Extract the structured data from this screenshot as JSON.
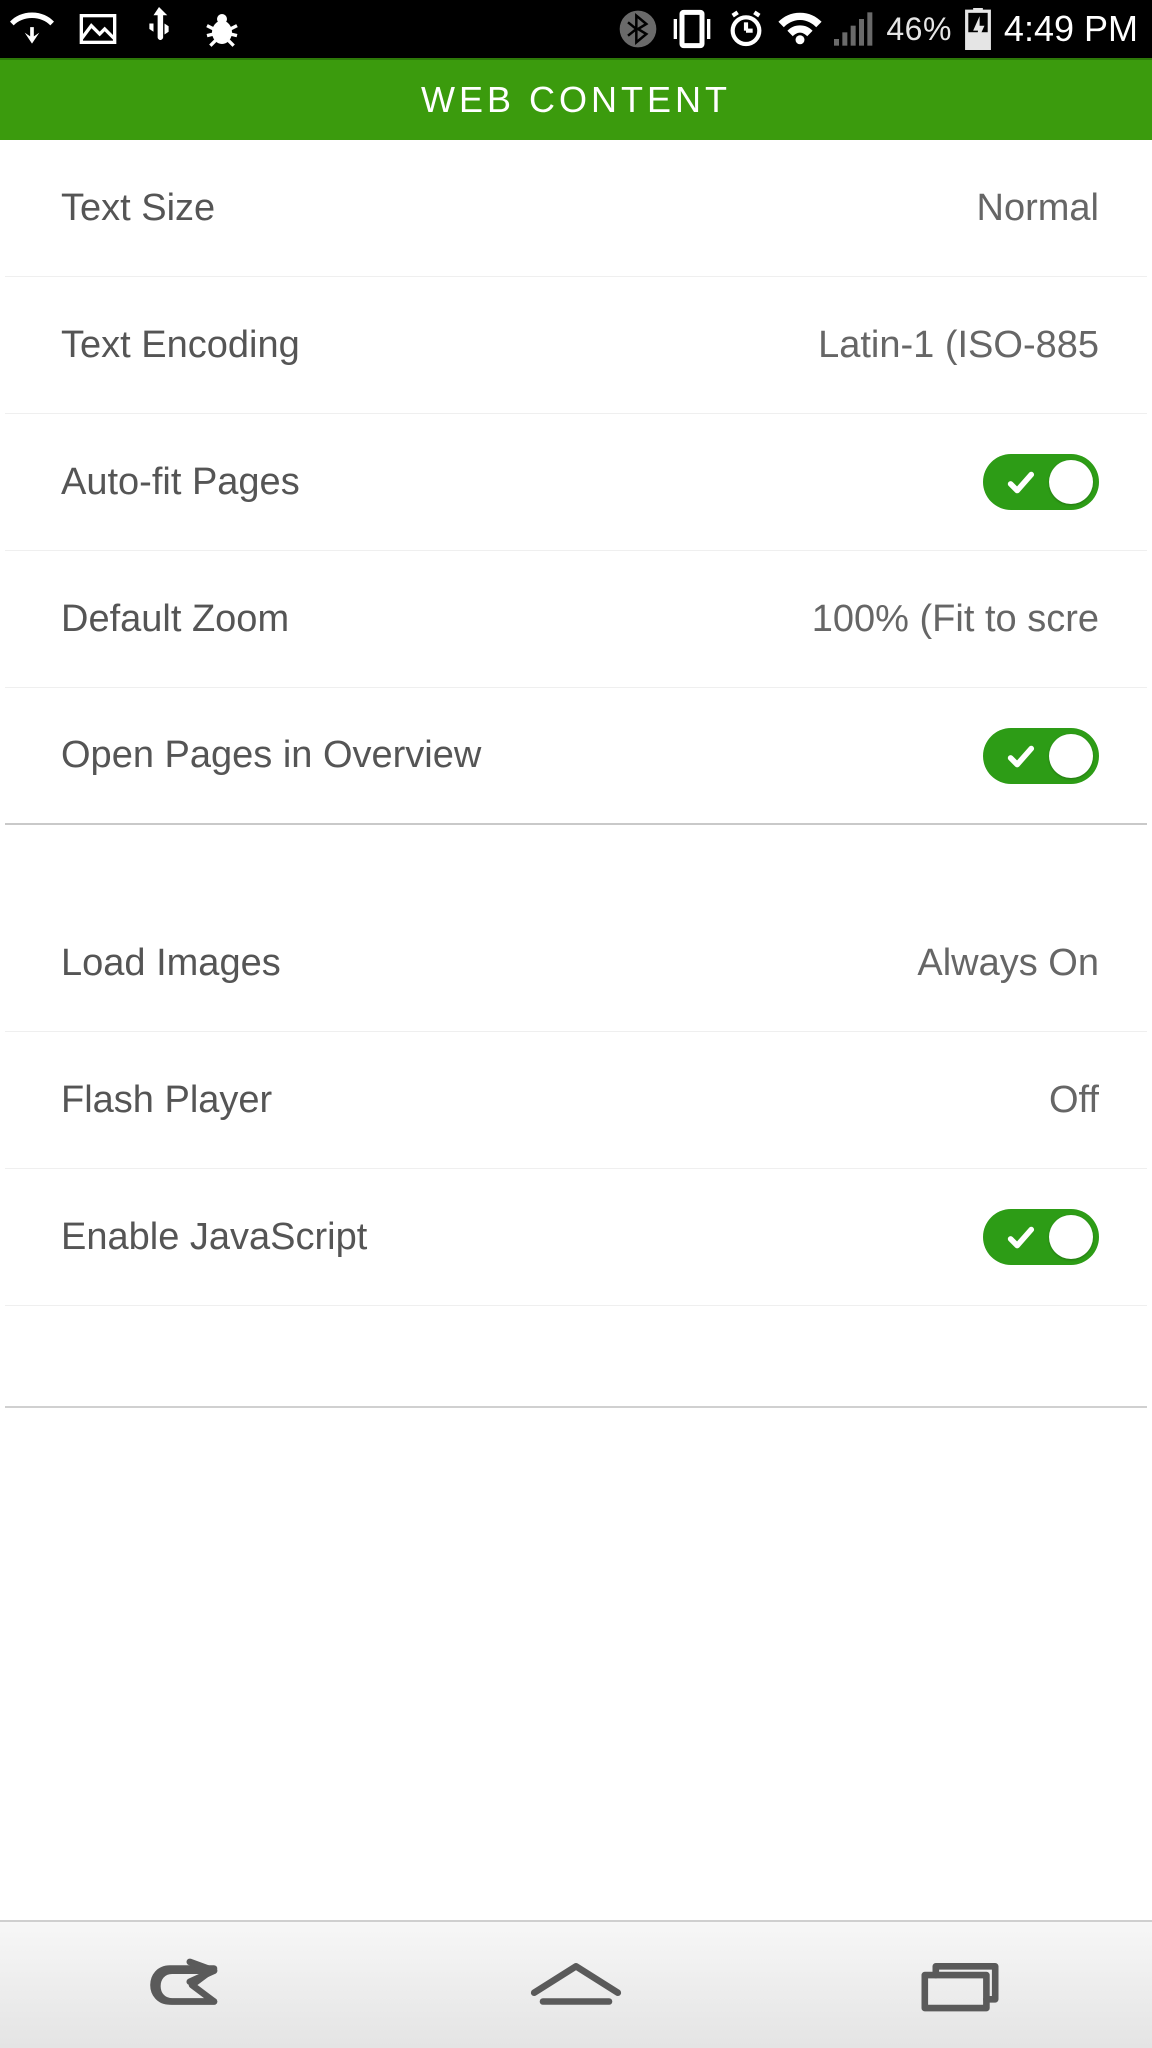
{
  "statusbar": {
    "battery_text": "46%",
    "time": "4:49 PM"
  },
  "header": {
    "title": "WEB CONTENT"
  },
  "settings": {
    "text_size": {
      "label": "Text Size",
      "value": "Normal"
    },
    "text_encoding": {
      "label": "Text Encoding",
      "value": "Latin-1 (ISO-885"
    },
    "auto_fit": {
      "label": "Auto-fit Pages",
      "on": true
    },
    "default_zoom": {
      "label": "Default Zoom",
      "value": "100% (Fit to scre"
    },
    "open_overview": {
      "label": "Open Pages in Overview",
      "on": true
    },
    "load_images": {
      "label": "Load Images",
      "value": "Always On"
    },
    "flash_player": {
      "label": "Flash Player",
      "value": "Off"
    },
    "enable_js": {
      "label": "Enable JavaScript",
      "on": true
    }
  }
}
